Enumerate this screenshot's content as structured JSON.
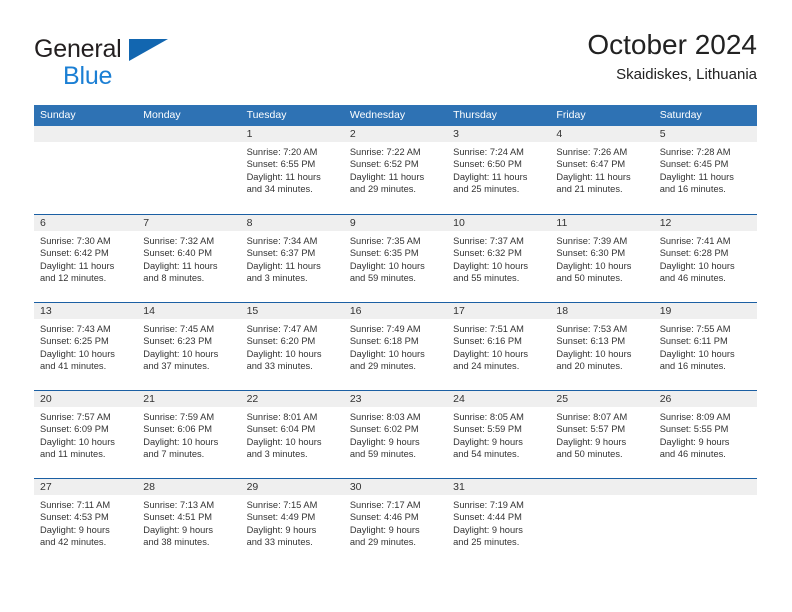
{
  "brand": {
    "line1": "General",
    "line2": "Blue",
    "triangle_color": "#1266b0",
    "blue_text_color": "#1b7fd4"
  },
  "header": {
    "title": "October 2024",
    "subtitle": "Skaidiskes, Lithuania"
  },
  "theme": {
    "header_blue": "#2e72b4",
    "row_rule_blue": "#1b5fa3",
    "day_strip_gray": "#efefef",
    "text": "#333333"
  },
  "weekdays": [
    {
      "label": "Sunday"
    },
    {
      "label": "Monday"
    },
    {
      "label": "Tuesday"
    },
    {
      "label": "Wednesday"
    },
    {
      "label": "Thursday"
    },
    {
      "label": "Friday"
    },
    {
      "label": "Saturday"
    }
  ],
  "labels": {
    "sunrise_prefix": "Sunrise:",
    "sunset_prefix": "Sunset:",
    "daylight_prefix": "Daylight:"
  },
  "weeks": [
    {
      "days": [
        {
          "day": "",
          "empty": true,
          "sunrise": "",
          "sunset": "",
          "daylight_line1": "",
          "daylight_line2": ""
        },
        {
          "day": "",
          "empty": true,
          "sunrise": "",
          "sunset": "",
          "daylight_line1": "",
          "daylight_line2": ""
        },
        {
          "day": "1",
          "empty": false,
          "sunrise": "Sunrise: 7:20 AM",
          "sunset": "Sunset: 6:55 PM",
          "daylight_line1": "Daylight: 11 hours",
          "daylight_line2": "and 34 minutes."
        },
        {
          "day": "2",
          "empty": false,
          "sunrise": "Sunrise: 7:22 AM",
          "sunset": "Sunset: 6:52 PM",
          "daylight_line1": "Daylight: 11 hours",
          "daylight_line2": "and 29 minutes."
        },
        {
          "day": "3",
          "empty": false,
          "sunrise": "Sunrise: 7:24 AM",
          "sunset": "Sunset: 6:50 PM",
          "daylight_line1": "Daylight: 11 hours",
          "daylight_line2": "and 25 minutes."
        },
        {
          "day": "4",
          "empty": false,
          "sunrise": "Sunrise: 7:26 AM",
          "sunset": "Sunset: 6:47 PM",
          "daylight_line1": "Daylight: 11 hours",
          "daylight_line2": "and 21 minutes."
        },
        {
          "day": "5",
          "empty": false,
          "sunrise": "Sunrise: 7:28 AM",
          "sunset": "Sunset: 6:45 PM",
          "daylight_line1": "Daylight: 11 hours",
          "daylight_line2": "and 16 minutes."
        }
      ]
    },
    {
      "days": [
        {
          "day": "6",
          "empty": false,
          "sunrise": "Sunrise: 7:30 AM",
          "sunset": "Sunset: 6:42 PM",
          "daylight_line1": "Daylight: 11 hours",
          "daylight_line2": "and 12 minutes."
        },
        {
          "day": "7",
          "empty": false,
          "sunrise": "Sunrise: 7:32 AM",
          "sunset": "Sunset: 6:40 PM",
          "daylight_line1": "Daylight: 11 hours",
          "daylight_line2": "and 8 minutes."
        },
        {
          "day": "8",
          "empty": false,
          "sunrise": "Sunrise: 7:34 AM",
          "sunset": "Sunset: 6:37 PM",
          "daylight_line1": "Daylight: 11 hours",
          "daylight_line2": "and 3 minutes."
        },
        {
          "day": "9",
          "empty": false,
          "sunrise": "Sunrise: 7:35 AM",
          "sunset": "Sunset: 6:35 PM",
          "daylight_line1": "Daylight: 10 hours",
          "daylight_line2": "and 59 minutes."
        },
        {
          "day": "10",
          "empty": false,
          "sunrise": "Sunrise: 7:37 AM",
          "sunset": "Sunset: 6:32 PM",
          "daylight_line1": "Daylight: 10 hours",
          "daylight_line2": "and 55 minutes."
        },
        {
          "day": "11",
          "empty": false,
          "sunrise": "Sunrise: 7:39 AM",
          "sunset": "Sunset: 6:30 PM",
          "daylight_line1": "Daylight: 10 hours",
          "daylight_line2": "and 50 minutes."
        },
        {
          "day": "12",
          "empty": false,
          "sunrise": "Sunrise: 7:41 AM",
          "sunset": "Sunset: 6:28 PM",
          "daylight_line1": "Daylight: 10 hours",
          "daylight_line2": "and 46 minutes."
        }
      ]
    },
    {
      "days": [
        {
          "day": "13",
          "empty": false,
          "sunrise": "Sunrise: 7:43 AM",
          "sunset": "Sunset: 6:25 PM",
          "daylight_line1": "Daylight: 10 hours",
          "daylight_line2": "and 41 minutes."
        },
        {
          "day": "14",
          "empty": false,
          "sunrise": "Sunrise: 7:45 AM",
          "sunset": "Sunset: 6:23 PM",
          "daylight_line1": "Daylight: 10 hours",
          "daylight_line2": "and 37 minutes."
        },
        {
          "day": "15",
          "empty": false,
          "sunrise": "Sunrise: 7:47 AM",
          "sunset": "Sunset: 6:20 PM",
          "daylight_line1": "Daylight: 10 hours",
          "daylight_line2": "and 33 minutes."
        },
        {
          "day": "16",
          "empty": false,
          "sunrise": "Sunrise: 7:49 AM",
          "sunset": "Sunset: 6:18 PM",
          "daylight_line1": "Daylight: 10 hours",
          "daylight_line2": "and 29 minutes."
        },
        {
          "day": "17",
          "empty": false,
          "sunrise": "Sunrise: 7:51 AM",
          "sunset": "Sunset: 6:16 PM",
          "daylight_line1": "Daylight: 10 hours",
          "daylight_line2": "and 24 minutes."
        },
        {
          "day": "18",
          "empty": false,
          "sunrise": "Sunrise: 7:53 AM",
          "sunset": "Sunset: 6:13 PM",
          "daylight_line1": "Daylight: 10 hours",
          "daylight_line2": "and 20 minutes."
        },
        {
          "day": "19",
          "empty": false,
          "sunrise": "Sunrise: 7:55 AM",
          "sunset": "Sunset: 6:11 PM",
          "daylight_line1": "Daylight: 10 hours",
          "daylight_line2": "and 16 minutes."
        }
      ]
    },
    {
      "days": [
        {
          "day": "20",
          "empty": false,
          "sunrise": "Sunrise: 7:57 AM",
          "sunset": "Sunset: 6:09 PM",
          "daylight_line1": "Daylight: 10 hours",
          "daylight_line2": "and 11 minutes."
        },
        {
          "day": "21",
          "empty": false,
          "sunrise": "Sunrise: 7:59 AM",
          "sunset": "Sunset: 6:06 PM",
          "daylight_line1": "Daylight: 10 hours",
          "daylight_line2": "and 7 minutes."
        },
        {
          "day": "22",
          "empty": false,
          "sunrise": "Sunrise: 8:01 AM",
          "sunset": "Sunset: 6:04 PM",
          "daylight_line1": "Daylight: 10 hours",
          "daylight_line2": "and 3 minutes."
        },
        {
          "day": "23",
          "empty": false,
          "sunrise": "Sunrise: 8:03 AM",
          "sunset": "Sunset: 6:02 PM",
          "daylight_line1": "Daylight: 9 hours",
          "daylight_line2": "and 59 minutes."
        },
        {
          "day": "24",
          "empty": false,
          "sunrise": "Sunrise: 8:05 AM",
          "sunset": "Sunset: 5:59 PM",
          "daylight_line1": "Daylight: 9 hours",
          "daylight_line2": "and 54 minutes."
        },
        {
          "day": "25",
          "empty": false,
          "sunrise": "Sunrise: 8:07 AM",
          "sunset": "Sunset: 5:57 PM",
          "daylight_line1": "Daylight: 9 hours",
          "daylight_line2": "and 50 minutes."
        },
        {
          "day": "26",
          "empty": false,
          "sunrise": "Sunrise: 8:09 AM",
          "sunset": "Sunset: 5:55 PM",
          "daylight_line1": "Daylight: 9 hours",
          "daylight_line2": "and 46 minutes."
        }
      ]
    },
    {
      "days": [
        {
          "day": "27",
          "empty": false,
          "sunrise": "Sunrise: 7:11 AM",
          "sunset": "Sunset: 4:53 PM",
          "daylight_line1": "Daylight: 9 hours",
          "daylight_line2": "and 42 minutes."
        },
        {
          "day": "28",
          "empty": false,
          "sunrise": "Sunrise: 7:13 AM",
          "sunset": "Sunset: 4:51 PM",
          "daylight_line1": "Daylight: 9 hours",
          "daylight_line2": "and 38 minutes."
        },
        {
          "day": "29",
          "empty": false,
          "sunrise": "Sunrise: 7:15 AM",
          "sunset": "Sunset: 4:49 PM",
          "daylight_line1": "Daylight: 9 hours",
          "daylight_line2": "and 33 minutes."
        },
        {
          "day": "30",
          "empty": false,
          "sunrise": "Sunrise: 7:17 AM",
          "sunset": "Sunset: 4:46 PM",
          "daylight_line1": "Daylight: 9 hours",
          "daylight_line2": "and 29 minutes."
        },
        {
          "day": "31",
          "empty": false,
          "sunrise": "Sunrise: 7:19 AM",
          "sunset": "Sunset: 4:44 PM",
          "daylight_line1": "Daylight: 9 hours",
          "daylight_line2": "and 25 minutes."
        },
        {
          "day": "",
          "empty": true,
          "sunrise": "",
          "sunset": "",
          "daylight_line1": "",
          "daylight_line2": ""
        },
        {
          "day": "",
          "empty": true,
          "sunrise": "",
          "sunset": "",
          "daylight_line1": "",
          "daylight_line2": ""
        }
      ]
    }
  ]
}
